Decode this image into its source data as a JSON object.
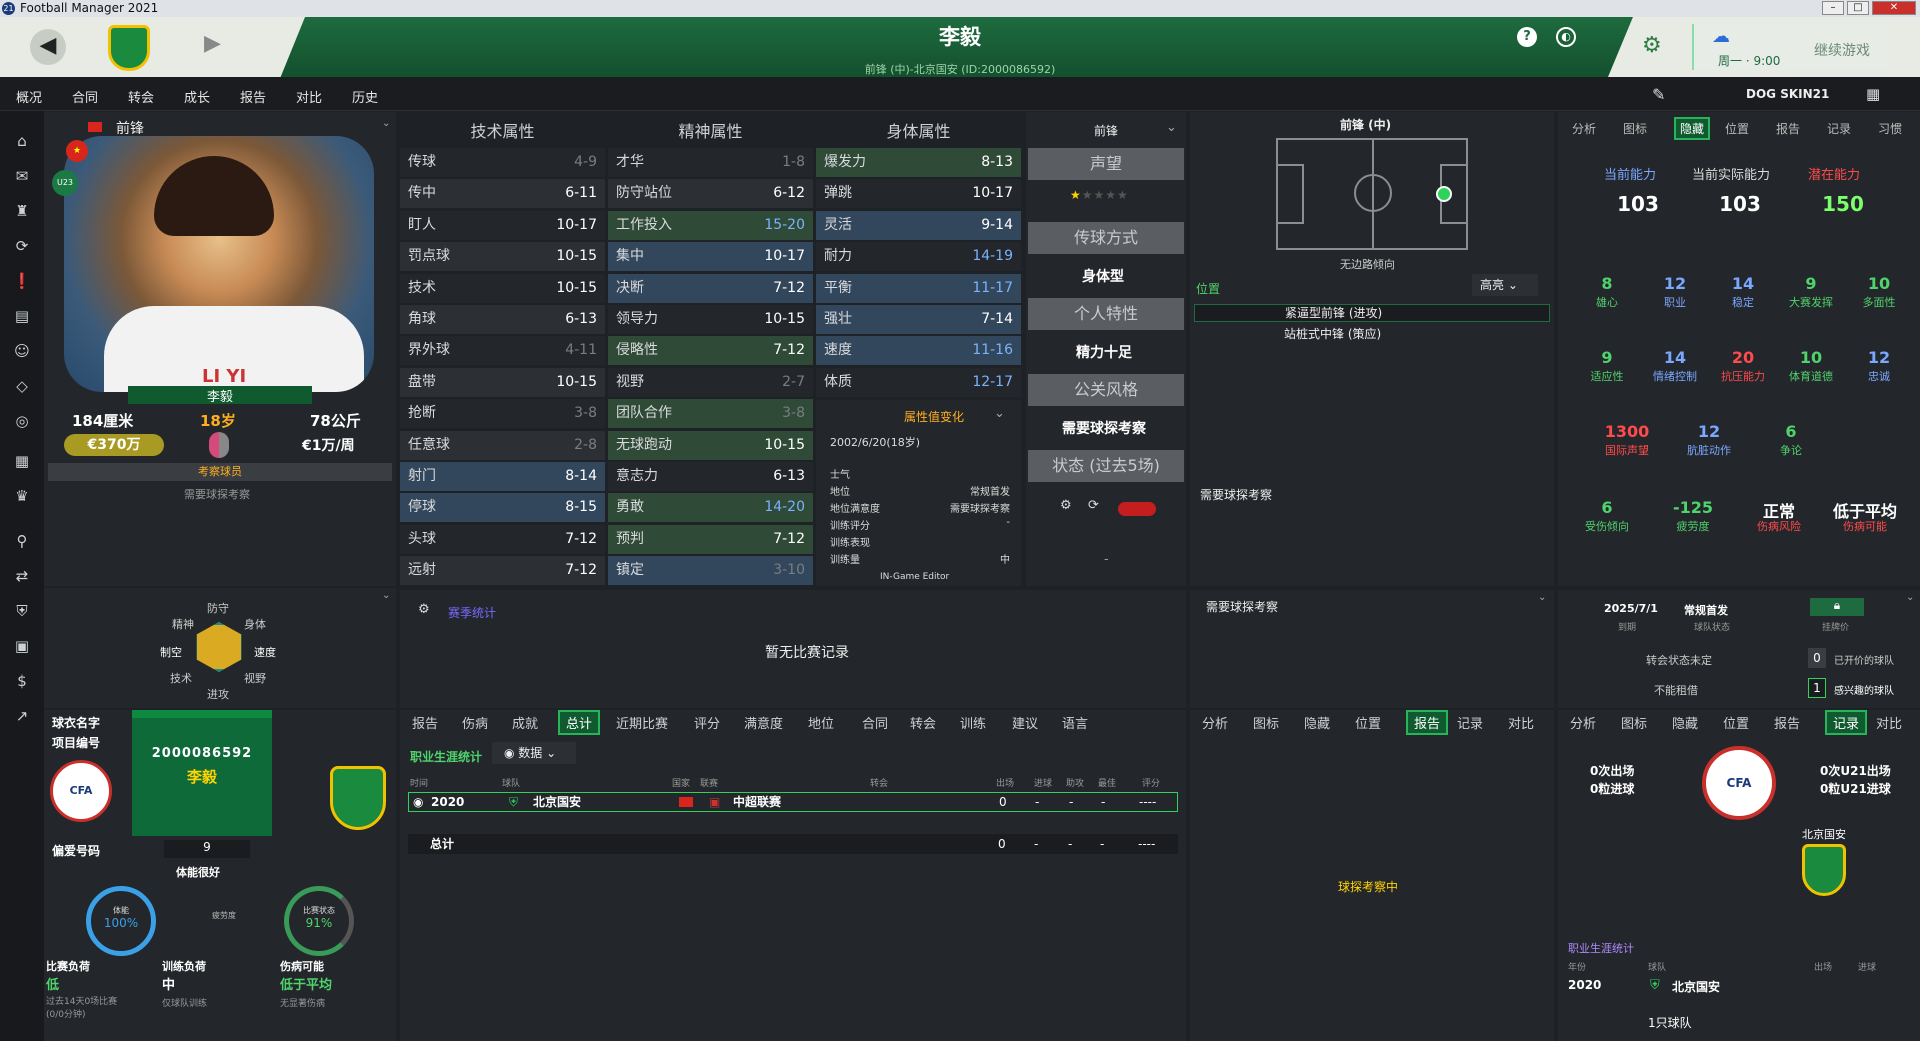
{
  "window": {
    "title": "Football Manager 2021"
  },
  "header": {
    "player_name": "李毅",
    "subtitle": "前锋 (中)-北京国安 (ID:2000086592)",
    "continue": "继续游戏",
    "date": "周一 · 9:00"
  },
  "menu": [
    {
      "label": "概况"
    },
    {
      "label": "合同"
    },
    {
      "label": "转会"
    },
    {
      "label": "成长"
    },
    {
      "label": "报告"
    },
    {
      "label": "对比"
    },
    {
      "label": "历史"
    }
  ],
  "skin": {
    "name": "DOG SKIN21"
  },
  "profile": {
    "position": "前锋",
    "name": "李毅",
    "height": "184厘米",
    "age": "18岁",
    "weight": "78公斤",
    "value": "€370万",
    "wage": "€1万/周",
    "u23": "U23",
    "youth_badge": "考察球员",
    "scout_note": "需要球探考察",
    "photo_caption": "LI YI"
  },
  "attr_headers": {
    "tech": "技术属性",
    "mental": "精神属性",
    "physical": "身体属性"
  },
  "tech": [
    {
      "name": "传球",
      "value": "4-9",
      "style": "dark",
      "vc": "grey"
    },
    {
      "name": "传中",
      "value": "6-11",
      "style": "mid",
      "vc": "white"
    },
    {
      "name": "盯人",
      "value": "10-17",
      "style": "dark",
      "vc": "white"
    },
    {
      "name": "罚点球",
      "value": "10-15",
      "style": "mid",
      "vc": "white"
    },
    {
      "name": "技术",
      "value": "10-15",
      "style": "dark",
      "vc": "white"
    },
    {
      "name": "角球",
      "value": "6-13",
      "style": "mid",
      "vc": "white"
    },
    {
      "name": "界外球",
      "value": "4-11",
      "style": "dark",
      "vc": "grey"
    },
    {
      "name": "盘带",
      "value": "10-15",
      "style": "mid",
      "vc": "white"
    },
    {
      "name": "抢断",
      "value": "3-8",
      "style": "dark",
      "vc": "grey"
    },
    {
      "name": "任意球",
      "value": "2-8",
      "style": "mid",
      "vc": "grey"
    },
    {
      "name": "射门",
      "value": "8-14",
      "style": "blue",
      "vc": "white"
    },
    {
      "name": "停球",
      "value": "8-15",
      "style": "blue",
      "vc": "white"
    },
    {
      "name": "头球",
      "value": "7-12",
      "style": "dark",
      "vc": "white"
    },
    {
      "name": "远射",
      "value": "7-12",
      "style": "mid",
      "vc": "white"
    }
  ],
  "mental": [
    {
      "name": "才华",
      "value": "1-8",
      "style": "dark",
      "vc": "grey"
    },
    {
      "name": "防守站位",
      "value": "6-12",
      "style": "mid",
      "vc": "white"
    },
    {
      "name": "工作投入",
      "value": "15-20",
      "style": "green",
      "vc": "blue"
    },
    {
      "name": "集中",
      "value": "10-17",
      "style": "blue",
      "vc": "white"
    },
    {
      "name": "决断",
      "value": "7-12",
      "style": "blue",
      "vc": "white"
    },
    {
      "name": "领导力",
      "value": "10-15",
      "style": "dark",
      "vc": "white"
    },
    {
      "name": "侵略性",
      "value": "7-12",
      "style": "green",
      "vc": "white"
    },
    {
      "name": "视野",
      "value": "2-7",
      "style": "dark",
      "vc": "grey"
    },
    {
      "name": "团队合作",
      "value": "3-8",
      "style": "green",
      "vc": "grey"
    },
    {
      "name": "无球跑动",
      "value": "10-15",
      "style": "green",
      "vc": "white"
    },
    {
      "name": "意志力",
      "value": "6-13",
      "style": "dark",
      "vc": "white"
    },
    {
      "name": "勇敢",
      "value": "14-20",
      "style": "green",
      "vc": "blue"
    },
    {
      "name": "预判",
      "value": "7-12",
      "style": "green",
      "vc": "white"
    },
    {
      "name": "镇定",
      "value": "3-10",
      "style": "blue",
      "vc": "grey"
    }
  ],
  "physical": [
    {
      "name": "爆发力",
      "value": "8-13",
      "style": "green",
      "vc": "white"
    },
    {
      "name": "弹跳",
      "value": "10-17",
      "style": "dark",
      "vc": "white"
    },
    {
      "name": "灵活",
      "value": "9-14",
      "style": "blue",
      "vc": "white"
    },
    {
      "name": "耐力",
      "value": "14-19",
      "style": "dark",
      "vc": "blue"
    },
    {
      "name": "平衡",
      "value": "11-17",
      "style": "blue",
      "vc": "blue"
    },
    {
      "name": "强壮",
      "value": "7-14",
      "style": "blue",
      "vc": "white"
    },
    {
      "name": "速度",
      "value": "11-16",
      "style": "blue",
      "vc": "blue"
    },
    {
      "name": "体质",
      "value": "12-17",
      "style": "dark",
      "vc": "blue"
    }
  ],
  "attr_change": {
    "label": "属性值变化",
    "date": "2002/6/20(18岁)",
    "rows": [
      {
        "k": "士气",
        "v": ""
      },
      {
        "k": "地位",
        "v": "常规首发"
      },
      {
        "k": "地位满意度",
        "v": "需要球探考察"
      },
      {
        "k": "训练评分",
        "v": "-"
      },
      {
        "k": "训练表现",
        "v": ""
      },
      {
        "k": "训练量",
        "v": "中"
      }
    ],
    "editor": "IN-Game Editor"
  },
  "side_col": {
    "position": "前锋",
    "reputation": "声望",
    "pass_style": "传球方式",
    "body_type": "身体型",
    "personal": "个人特性",
    "energy": "精力十足",
    "pr_style": "公关风格",
    "need_scout": "需要球探考察",
    "form": "状态 (过去5场)",
    "dash": "-"
  },
  "pitch": {
    "title": "前锋 (中)",
    "foot": "无边路倾向",
    "pos_label": "位置",
    "highlight": "高亮",
    "roles": [
      "紧逼型前锋 (进攻)",
      "站桩式中锋 (策应)"
    ],
    "scout": "需要球探考察"
  },
  "right_tabs": [
    "分析",
    "图标",
    "隐藏",
    "位置",
    "报告",
    "记录",
    "习惯"
  ],
  "ability": {
    "ca_label": "当前能力",
    "real_label": "当前实际能力",
    "pa_label": "潜在能力",
    "ca": "103",
    "real": "103",
    "pa": "150"
  },
  "hidden_rows": [
    [
      {
        "v": "8",
        "l": "雄心",
        "c": "green"
      },
      {
        "v": "12",
        "l": "职业",
        "c": "blue"
      },
      {
        "v": "14",
        "l": "稳定",
        "c": "blue"
      },
      {
        "v": "9",
        "l": "大赛发挥",
        "c": "green"
      },
      {
        "v": "10",
        "l": "多面性",
        "c": "green"
      }
    ],
    [
      {
        "v": "9",
        "l": "适应性",
        "c": "green"
      },
      {
        "v": "14",
        "l": "情绪控制",
        "c": "blue"
      },
      {
        "v": "20",
        "l": "抗压能力",
        "c": "red"
      },
      {
        "v": "10",
        "l": "体育道德",
        "c": "green"
      },
      {
        "v": "12",
        "l": "忠诚",
        "c": "blue"
      }
    ],
    [
      {
        "v": "1300",
        "l": "国际声望",
        "c": "red"
      },
      {
        "v": "12",
        "l": "肮脏动作",
        "c": "blue"
      },
      {
        "v": "6",
        "l": "争论",
        "c": "green"
      }
    ],
    [
      {
        "v": "6",
        "l": "受伤倾向",
        "c": "green"
      },
      {
        "v": "-125",
        "l": "疲劳度",
        "c": "green"
      },
      {
        "v": "正常",
        "l": "伤病风险",
        "c": "white"
      },
      {
        "v": "低于平均",
        "l": "伤病可能",
        "c": "white"
      }
    ]
  ],
  "radar": {
    "top": "防守",
    "mental": "精神",
    "physical": "身体",
    "control": "制空",
    "speed": "速度",
    "tech": "技术",
    "vision": "视野",
    "attack": "进攻"
  },
  "match_stats": {
    "label": "赛季统计",
    "empty": "暂无比赛记录"
  },
  "scout_mid": "需要球探考察",
  "contract": {
    "date": "2025/7/1",
    "date_lbl": "到期",
    "status": "常规首发",
    "status_lbl": "球队状态",
    "lock_lbl": "挂牌价",
    "transfer": "转会状态未定",
    "offers": "0",
    "offers_lbl": "已开价的球队",
    "loan": "不能租借",
    "interest": "1",
    "interest_lbl": "感兴趣的球队"
  },
  "bottom_tabs": [
    "报告",
    "伤病",
    "成就",
    "总计",
    "近期比赛",
    "评分",
    "满意度",
    "地位",
    "合同",
    "转会",
    "训练",
    "建议",
    "语言"
  ],
  "career": {
    "title": "职业生涯统计",
    "mode": "数据",
    "cols": [
      "时间",
      "球队",
      "国家",
      "联赛",
      "转会",
      "出场",
      "进球",
      "助攻",
      "最佳",
      "评分"
    ],
    "row": {
      "year": "2020",
      "team": "北京国安",
      "league": "中超联赛",
      "apps": "0",
      "goals": "-",
      "assists": "-",
      "pom": "-",
      "rating": "----"
    },
    "total": {
      "label": "总计",
      "apps": "0",
      "goals": "-",
      "assists": "-",
      "pom": "-",
      "rating": "----"
    }
  },
  "mid_tabs": [
    "分析",
    "图标",
    "隐藏",
    "位置",
    "报告",
    "记录",
    "对比"
  ],
  "scouting": "球探考察中",
  "right2_tabs": [
    "分析",
    "图标",
    "隐藏",
    "位置",
    "报告",
    "记录",
    "对比"
  ],
  "intl": {
    "caps": "0次出场",
    "goals": "0粒进球",
    "u21caps": "0次U21出场",
    "u21goals": "0粒U21进球",
    "club": "北京国安",
    "career": "职业生涯统计",
    "year_lbl": "年份",
    "club_lbl": "球队",
    "apps_lbl": "出场",
    "goals_lbl": "进球",
    "year": "2020",
    "team": "北京国安",
    "teams": "1只球队"
  },
  "kit": {
    "name_lbl": "球衣名字",
    "num_lbl": "项目编号",
    "id": "2000086592",
    "name": "李毅",
    "fav_lbl": "偏爱号码",
    "fav": "9",
    "fitness": "体能很好",
    "cond_lbl": "体能",
    "cond": "100%",
    "fatigue": "疲劳度",
    "sharp_lbl": "比赛状态",
    "sharp": "91%",
    "load_lbl": "比赛负荷",
    "load": "低",
    "load_note": "过去14天0场比赛 (0/0分钟)",
    "train_lbl": "训练负荷",
    "train": "中",
    "train_note": "仅球队训练",
    "inj_lbl": "伤病可能",
    "inj": "低于平均",
    "inj_note": "无显著伤病"
  },
  "colors": {
    "accent": "#29b35a",
    "header": "#1e6b3f",
    "blue": "#7aa7ff",
    "red": "#ff4b4b",
    "yellow": "#ffd400"
  }
}
